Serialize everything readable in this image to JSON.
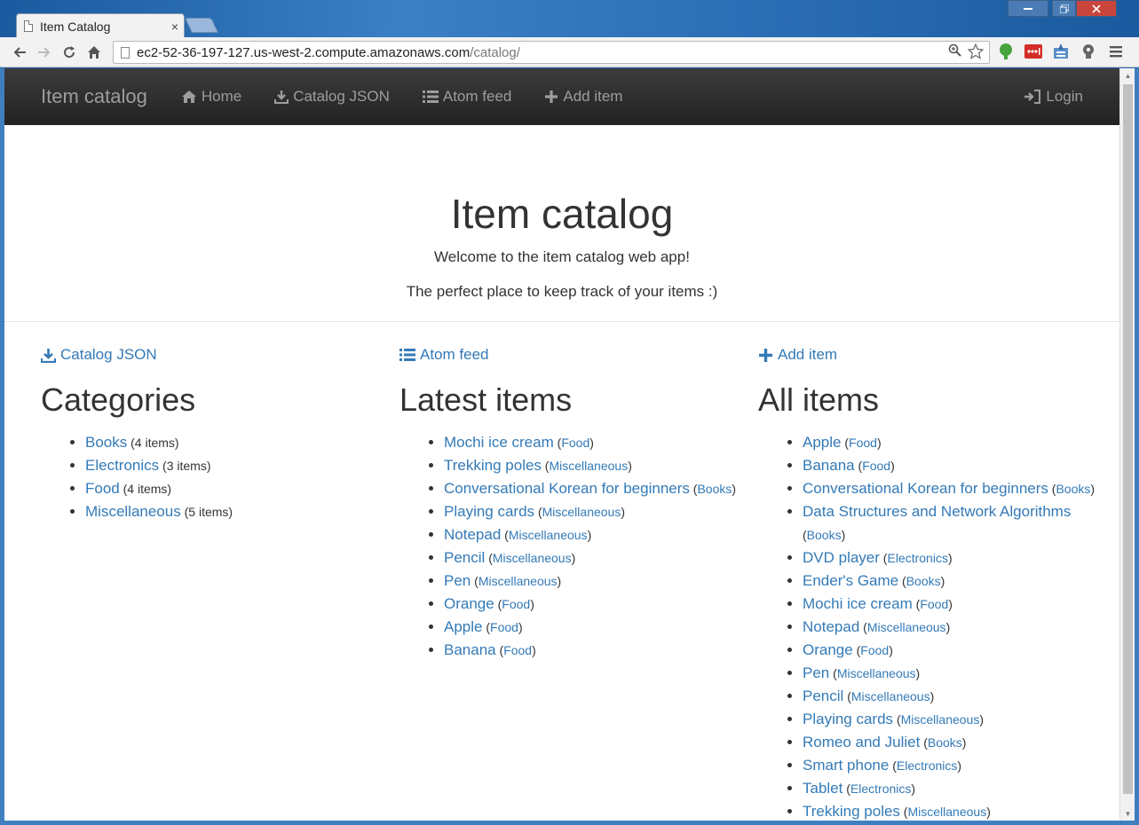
{
  "browser": {
    "tab_title": "Item Catalog",
    "tab_close": "×",
    "url_host": "ec2-52-36-197-127.us-west-2.compute.amazonaws.com",
    "url_path": "/catalog/",
    "window_minimize": "—",
    "window_restore": "❐",
    "window_close": "✕"
  },
  "navbar": {
    "brand": "Item catalog",
    "links": {
      "home": "Home",
      "catalog_json": "Catalog JSON",
      "atom_feed": "Atom feed",
      "add_item": "Add item"
    },
    "login": "Login"
  },
  "jumbotron": {
    "title": "Item catalog",
    "line1": "Welcome to the item catalog web app!",
    "line2": "The perfect place to keep track of your items :)"
  },
  "categories_col": {
    "action": "Catalog JSON",
    "heading": "Categories",
    "items": [
      {
        "name": "Books",
        "count": "(4 items)"
      },
      {
        "name": "Electronics",
        "count": "(3 items)"
      },
      {
        "name": "Food",
        "count": "(4 items)"
      },
      {
        "name": "Miscellaneous",
        "count": "(5 items)"
      }
    ]
  },
  "latest_col": {
    "action": "Atom feed",
    "heading": "Latest items",
    "items": [
      {
        "name": "Mochi ice cream",
        "cat": "Food"
      },
      {
        "name": "Trekking poles",
        "cat": "Miscellaneous"
      },
      {
        "name": "Conversational Korean for beginners",
        "cat": "Books"
      },
      {
        "name": "Playing cards",
        "cat": "Miscellaneous"
      },
      {
        "name": "Notepad",
        "cat": "Miscellaneous"
      },
      {
        "name": "Pencil",
        "cat": "Miscellaneous"
      },
      {
        "name": "Pen",
        "cat": "Miscellaneous"
      },
      {
        "name": "Orange",
        "cat": "Food"
      },
      {
        "name": "Apple",
        "cat": "Food"
      },
      {
        "name": "Banana",
        "cat": "Food"
      }
    ]
  },
  "all_col": {
    "action": "Add item",
    "heading": "All items",
    "items": [
      {
        "name": "Apple",
        "cat": "Food"
      },
      {
        "name": "Banana",
        "cat": "Food"
      },
      {
        "name": "Conversational Korean for beginners",
        "cat": "Books"
      },
      {
        "name": "Data Structures and Network Algorithms",
        "cat": "Books"
      },
      {
        "name": "DVD player",
        "cat": "Electronics"
      },
      {
        "name": "Ender's Game",
        "cat": "Books"
      },
      {
        "name": "Mochi ice cream",
        "cat": "Food"
      },
      {
        "name": "Notepad",
        "cat": "Miscellaneous"
      },
      {
        "name": "Orange",
        "cat": "Food"
      },
      {
        "name": "Pen",
        "cat": "Miscellaneous"
      },
      {
        "name": "Pencil",
        "cat": "Miscellaneous"
      },
      {
        "name": "Playing cards",
        "cat": "Miscellaneous"
      },
      {
        "name": "Romeo and Juliet",
        "cat": "Books"
      },
      {
        "name": "Smart phone",
        "cat": "Electronics"
      },
      {
        "name": "Tablet",
        "cat": "Electronics"
      },
      {
        "name": "Trekking poles",
        "cat": "Miscellaneous"
      }
    ]
  },
  "colors": {
    "link": "#337ab7",
    "navbar_bg": "#222222",
    "navbar_text": "#9d9d9d"
  }
}
